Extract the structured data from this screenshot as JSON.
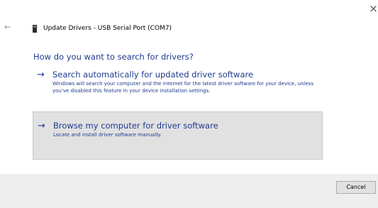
{
  "window": {
    "title": "Update Drivers - USB Serial Port (COM7)",
    "close_glyph": "×",
    "back_glyph": "←"
  },
  "icons": {
    "close": "close-icon",
    "back": "back-arrow-icon",
    "device": "usb-device-icon",
    "option_arrow": "right-arrow-icon"
  },
  "heading": "How do you want to search for drivers?",
  "options": [
    {
      "arrow": "→",
      "title": "Search automatically for updated driver software",
      "description": "Windows will search your computer and the Internet for the latest driver software for your device, unless you've disabled this feature in your device installation settings."
    },
    {
      "arrow": "→",
      "title": "Browse my computer for driver software",
      "description": "Locate and install driver software manually."
    }
  ],
  "footer": {
    "cancel_label": "Cancel"
  },
  "colors": {
    "link_blue": "#1e3a8f",
    "hover_background": "#e1e1e1",
    "footer_background": "#eeeeee"
  }
}
